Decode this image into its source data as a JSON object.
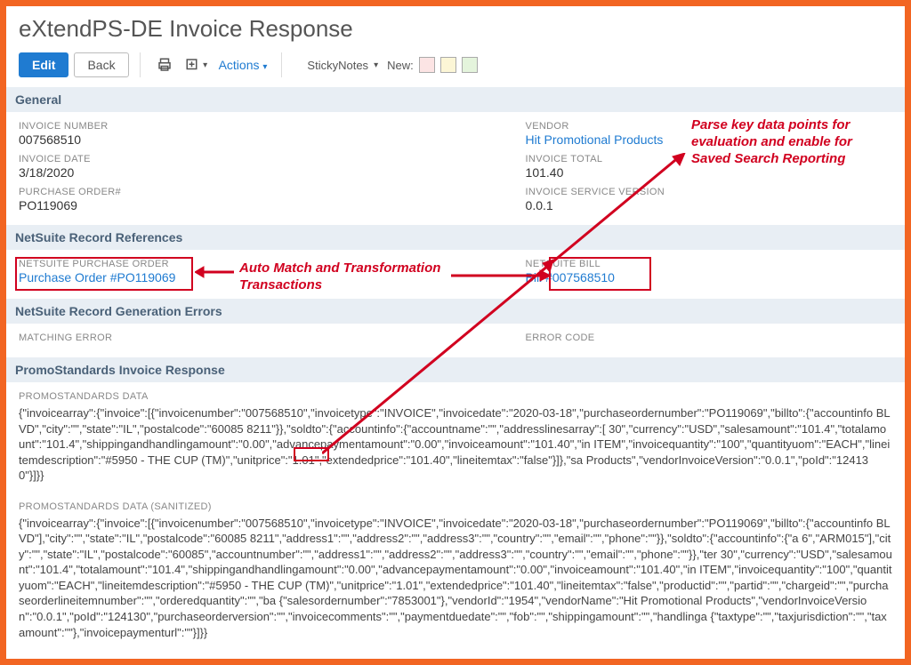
{
  "page_title": "eXtendPS-DE Invoice Response",
  "toolbar": {
    "edit": "Edit",
    "back": "Back",
    "actions": "Actions",
    "sticky": "StickyNotes",
    "new": "New:"
  },
  "sections": {
    "general": "General",
    "refs": "NetSuite Record References",
    "errors": "NetSuite Record Generation Errors",
    "promo": "PromoStandards Invoice Response"
  },
  "general_left": {
    "inv_num_l": "INVOICE NUMBER",
    "inv_num_v": "007568510",
    "inv_date_l": "INVOICE DATE",
    "inv_date_v": "3/18/2020",
    "po_l": "PURCHASE ORDER#",
    "po_v": "PO119069"
  },
  "general_right": {
    "vendor_l": "VENDOR",
    "vendor_v": "Hit Promotional Products",
    "total_l": "INVOICE TOTAL",
    "total_v": "101.40",
    "isv_l": "INVOICE SERVICE VERSION",
    "isv_v": "0.0.1"
  },
  "refs_left": {
    "l": "NETSUITE PURCHASE ORDER",
    "v": "Purchase Order #PO119069"
  },
  "refs_right": {
    "l": "NETSUITE BILL",
    "v": "Bill #007568510"
  },
  "errors_left": {
    "l": "MATCHING ERROR"
  },
  "errors_right": {
    "l": "ERROR CODE"
  },
  "promo_data_l": "PROMOSTANDARDS DATA",
  "promo_data_v": "{\"invoicearray\":{\"invoice\":[{\"invoicenumber\":\"007568510\",\"invoicetype\":\"INVOICE\",\"invoicedate\":\"2020-03-18\",\"purchaseordernumber\":\"PO119069\",\"billto\":{\"accountinfo BLVD\",\"city\":\"\",\"state\":\"IL\",\"postalcode\":\"60085 8211\"}},\"soldto\":{\"accountinfo\":{\"accountname\":\"\",\"addresslinesarray\":[ 30\",\"currency\":\"USD\",\"salesamount\":\"101.4\",\"totalamount\":\"101.4\",\"shippingandhandlingamount\":\"0.00\",\"advancepaymentamount\":\"0.00\",\"invoiceamount\":\"101.40\",\"in ITEM\",\"invoicequantity\":\"100\",\"quantityuom\":\"EACH\",\"lineitemdescription\":\"#5950 - THE CUP (TM)\",\"unitprice\":\"1.01\",\"extendedprice\":\"101.40\",\"lineitemtax\":\"false\"}]},\"sa Products\",\"vendorInvoiceVersion\":\"0.0.1\",\"poId\":\"124130\"}]}}",
  "promo_san_l": "PROMOSTANDARDS DATA (SANITIZED)",
  "promo_san_v": "{\"invoicearray\":{\"invoice\":[{\"invoicenumber\":\"007568510\",\"invoicetype\":\"INVOICE\",\"invoicedate\":\"2020-03-18\",\"purchaseordernumber\":\"PO119069\",\"billto\":{\"accountinfo BLVD\"],\"city\":\"\",\"state\":\"IL\",\"postalcode\":\"60085 8211\",\"address1\":\"\",\"address2\":\"\",\"address3\":\"\",\"country\":\"\",\"email\":\"\",\"phone\":\"\"}},\"soldto\":{\"accountinfo\":{\"a 6\",\"ARM015\"],\"city\":\"\",\"state\":\"IL\",\"postalcode\":\"60085\",\"accountnumber\":\"\",\"address1\":\"\",\"address2\":\"\",\"address3\":\"\",\"country\":\"\",\"email\":\"\",\"phone\":\"\"}},\"ter 30\",\"currency\":\"USD\",\"salesamount\":\"101.4\",\"totalamount\":\"101.4\",\"shippingandhandlingamount\":\"0.00\",\"advancepaymentamount\":\"0.00\",\"invoiceamount\":\"101.40\",\"in ITEM\",\"invoicequantity\":\"100\",\"quantityuom\":\"EACH\",\"lineitemdescription\":\"#5950 - THE CUP (TM)\",\"unitprice\":\"1.01\",\"extendedprice\":\"101.40\",\"lineitemtax\":\"false\",\"productid\":\"\",\"partid\":\"\",\"chargeid\":\"\",\"purchaseorderlineitemnumber\":\"\",\"orderedquantity\":\"\",\"ba {\"salesordernumber\":\"7853001\"},\"vendorId\":\"1954\",\"vendorName\":\"Hit Promotional Products\",\"vendorInvoiceVersion\":\"0.0.1\",\"poId\":\"124130\",\"purchaseorderversion\":\"\",\"invoicecomments\":\"\",\"paymentduedate\":\"\",\"fob\":\"\",\"shippingamount\":\"\",\"handlinga {\"taxtype\":\"\",\"taxjurisdiction\":\"\",\"taxamount\":\"\"},\"invoicepaymenturl\":\"\"}]}}",
  "annotations": {
    "parse": "Parse key data points for evaluation and enable for Saved Search Reporting",
    "auto": "Auto Match and Transformation Transactions"
  }
}
